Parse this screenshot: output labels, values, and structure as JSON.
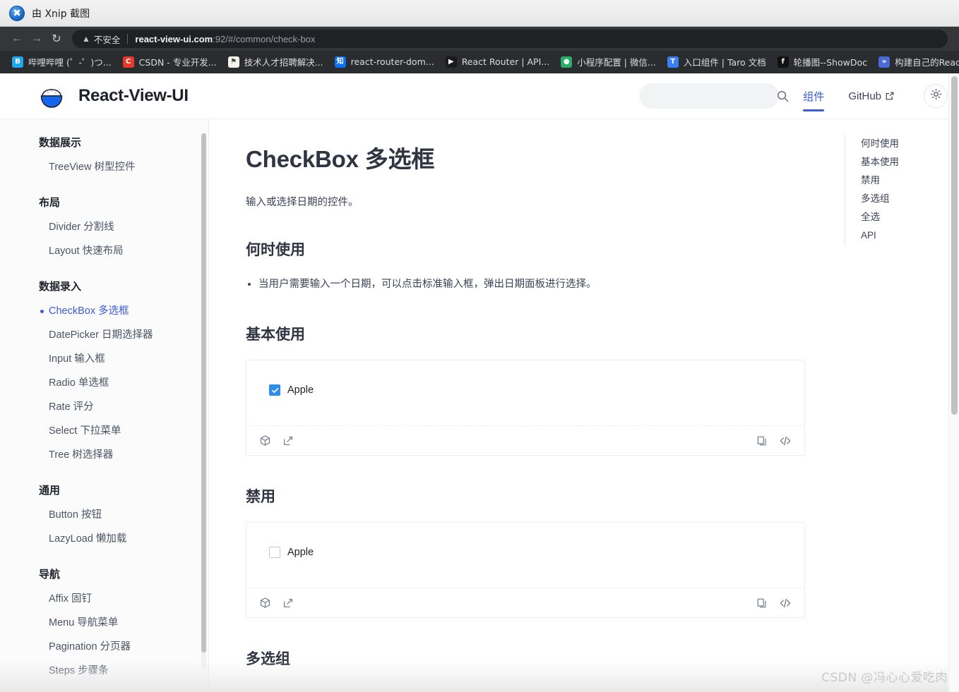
{
  "capture_bar": {
    "label": "由 Xnip 截图",
    "icon": "xnip-logo-icon"
  },
  "browser": {
    "back_icon": "back-arrow-icon",
    "forward_icon": "forward-arrow-icon",
    "reload_icon": "reload-icon",
    "security_icon": "warning-triangle-icon",
    "security_text": "不安全",
    "url_host": "react-view-ui.com",
    "url_rest": ":92/#/common/check-box",
    "bookmarks": [
      {
        "label": "哔哩哔哩 (゜-゜)つ...",
        "fav_text": "B",
        "fav_color": "#22a7f0"
      },
      {
        "label": "CSDN - 专业开发...",
        "fav_text": "C",
        "fav_color": "#e8382a"
      },
      {
        "label": "技术人才招聘解决...",
        "fav_text": "⚑",
        "fav_color": "#f5f2ea"
      },
      {
        "label": "react-router-dom...",
        "fav_text": "知",
        "fav_color": "#0c70f2"
      },
      {
        "label": "React Router | API...",
        "fav_text": "▶",
        "fav_color": "#1a1a1a"
      },
      {
        "label": "小程序配置 | 微信...",
        "fav_text": "●",
        "fav_color": "#2aae67"
      },
      {
        "label": "入口组件 | Taro 文档",
        "fav_text": "T",
        "fav_color": "#3b7ff5"
      },
      {
        "label": "轮播图--ShowDoc",
        "fav_text": "f",
        "fav_color": "#111111"
      },
      {
        "label": "构建自己的React...",
        "fav_text": "»",
        "fav_color": "#4a6bd6"
      },
      {
        "label": "",
        "fav_text": "◑",
        "fav_color": "#2d6fe0"
      }
    ]
  },
  "site_header": {
    "brand": "React-View-UI",
    "logo_icon": "rice-bowl-logo-icon",
    "search": {
      "value": "",
      "placeholder": "",
      "icon": "search-icon"
    },
    "nav": [
      {
        "label": "组件",
        "active": true
      },
      {
        "label": "GitHub",
        "active": false,
        "external_icon": "external-link-icon"
      }
    ],
    "theme_toggle_icon": "sun-icon"
  },
  "sidebar": {
    "groups": [
      {
        "title": "数据展示",
        "items": [
          {
            "label": "TreeView 树型控件",
            "active": false
          }
        ]
      },
      {
        "title": "布局",
        "items": [
          {
            "label": "Divider 分割线",
            "active": false
          },
          {
            "label": "Layout 快速布局",
            "active": false
          }
        ]
      },
      {
        "title": "数据录入",
        "items": [
          {
            "label": "CheckBox 多选框",
            "active": true
          },
          {
            "label": "DatePicker 日期选择器",
            "active": false
          },
          {
            "label": "Input 输入框",
            "active": false
          },
          {
            "label": "Radio 单选框",
            "active": false
          },
          {
            "label": "Rate 评分",
            "active": false
          },
          {
            "label": "Select 下拉菜单",
            "active": false
          },
          {
            "label": "Tree 树选择器",
            "active": false
          }
        ]
      },
      {
        "title": "通用",
        "items": [
          {
            "label": "Button 按钮",
            "active": false
          },
          {
            "label": "LazyLoad 懒加载",
            "active": false
          }
        ]
      },
      {
        "title": "导航",
        "items": [
          {
            "label": "Affix 固钉",
            "active": false
          },
          {
            "label": "Menu 导航菜单",
            "active": false
          },
          {
            "label": "Pagination 分页器",
            "active": false
          },
          {
            "label": "Steps 步骤条",
            "active": false
          }
        ]
      }
    ]
  },
  "doc": {
    "title": "CheckBox 多选框",
    "description": "输入或选择日期的控件。",
    "when_to_use": {
      "heading": "何时使用",
      "bullets": [
        "当用户需要输入一个日期，可以点击标准输入框，弹出日期面板进行选择。"
      ]
    },
    "basic": {
      "heading": "基本使用",
      "checkbox_label": "Apple",
      "checked": true
    },
    "disabled": {
      "heading": "禁用",
      "checkbox_label": "Apple",
      "checked": false
    },
    "group": {
      "heading": "多选组"
    },
    "demo_toolbar": {
      "codesandbox_icon": "codesandbox-icon",
      "external_icon": "external-link-icon",
      "copy_icon": "copy-icon",
      "code_icon": "code-brackets-icon"
    }
  },
  "toc": {
    "items": [
      {
        "label": "何时使用"
      },
      {
        "label": "基本使用"
      },
      {
        "label": "禁用"
      },
      {
        "label": "多选组"
      },
      {
        "label": "全选"
      },
      {
        "label": "API"
      }
    ]
  },
  "watermark": "CSDN @冯心心爱吃肉",
  "colors": {
    "accent": "#3b5bdb",
    "checkbox_checked": "#2d8cf0",
    "heading": "#303342",
    "toolbar_bg": "#35363a",
    "bookmarks_bg": "#2b2c2f"
  }
}
